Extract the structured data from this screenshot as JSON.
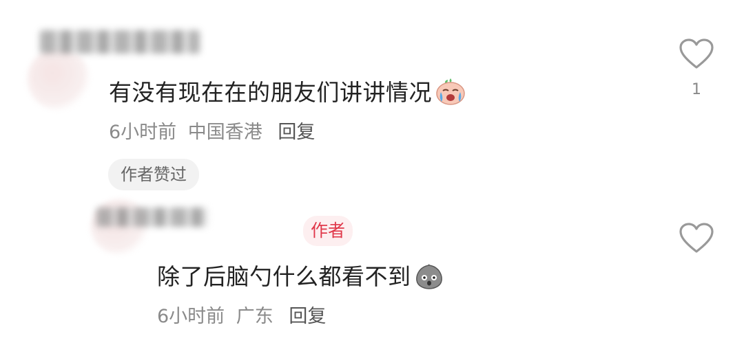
{
  "comments": [
    {
      "text": "有没有现在在的朋友们讲讲情况",
      "emoji": "crying-face-emoji",
      "time": "6小时前",
      "location": "中国香港",
      "reply_label": "回复",
      "badge": "作者赞过",
      "like_count": "1"
    },
    {
      "author_tag": "作者",
      "text": "除了后脑勺什么都看不到",
      "emoji": "shocked-face-emoji",
      "time": "6小时前",
      "location": "广东",
      "reply_label": "回复"
    }
  ],
  "colors": {
    "text": "#222222",
    "meta": "#8a8a8a",
    "author_tag_text": "#e0384a",
    "author_tag_bg": "#fdeff0",
    "badge_bg": "#f2f2f2",
    "heart_outline": "#999999"
  }
}
